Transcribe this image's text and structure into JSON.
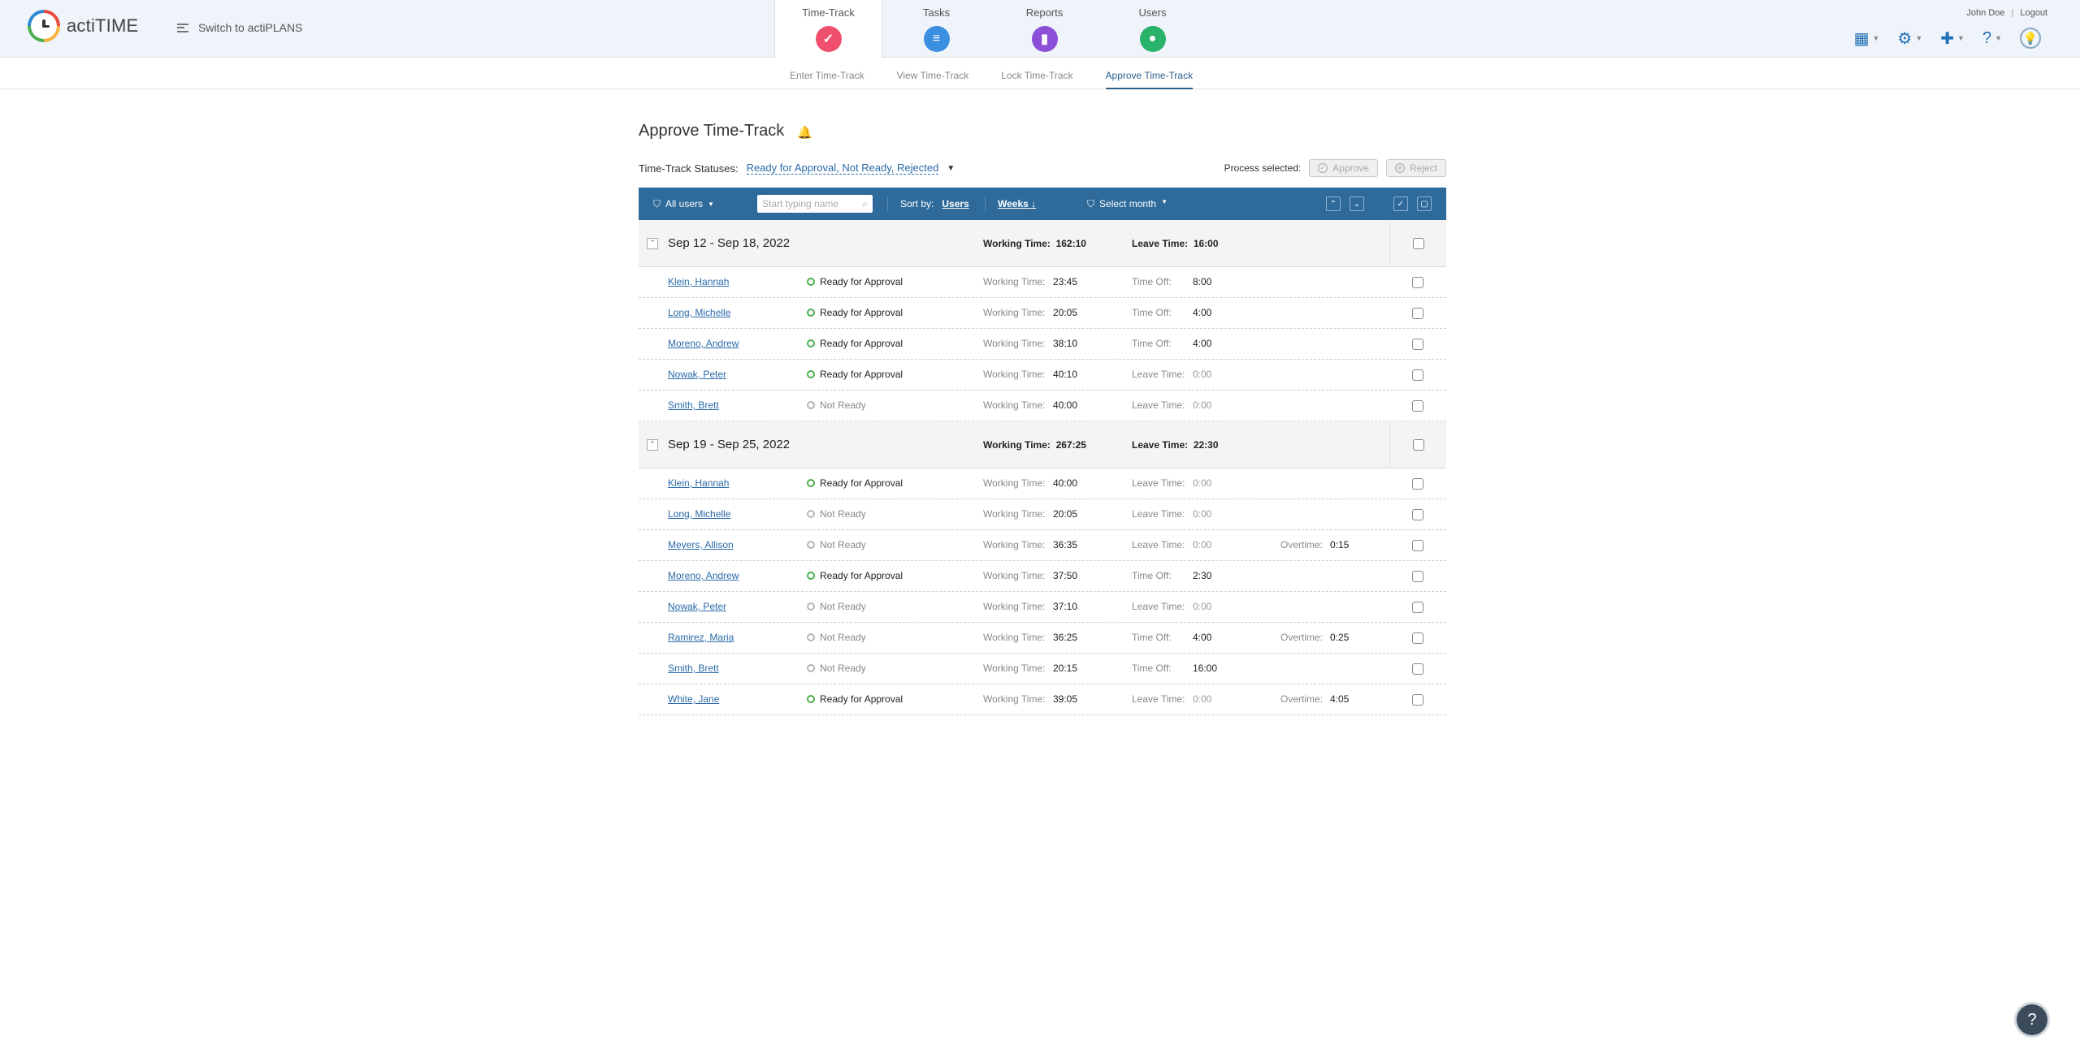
{
  "app": {
    "name": "actiTIME",
    "switch_label": "Switch to actiPLANS"
  },
  "modules": [
    {
      "label": "Time-Track",
      "color": "#f0506e",
      "glyph": "✓"
    },
    {
      "label": "Tasks",
      "color": "#3b8fe0",
      "glyph": "≡"
    },
    {
      "label": "Reports",
      "color": "#8b4fd8",
      "glyph": "▮"
    },
    {
      "label": "Users",
      "color": "#28b26a",
      "glyph": "●"
    }
  ],
  "user": {
    "name": "John Doe",
    "logout": "Logout"
  },
  "subnav": [
    "Enter Time-Track",
    "View Time-Track",
    "Lock Time-Track",
    "Approve Time-Track"
  ],
  "page": {
    "title": "Approve Time-Track"
  },
  "filters": {
    "statuses_label": "Time-Track Statuses:",
    "statuses_value": "Ready for Approval, Not Ready, Rejected",
    "process_label": "Process selected:",
    "approve": "Approve",
    "reject": "Reject"
  },
  "toolbar": {
    "all_users": "All users",
    "search_placeholder": "Start typing name",
    "sort_by": "Sort by:",
    "sort_users": "Users",
    "weeks": "Weeks",
    "select_month": "Select month"
  },
  "labels": {
    "working_time": "Working Time:",
    "leave_time": "Leave Time:",
    "time_off": "Time Off:",
    "overtime": "Overtime:"
  },
  "weeks": [
    {
      "title": "Sep 12 - Sep 18, 2022",
      "working_time": "162:10",
      "leave_time": "16:00",
      "rows": [
        {
          "name": "Klein, Hannah",
          "status": "Ready for Approval",
          "ready": true,
          "working": "23:45",
          "leave_type": "Time Off:",
          "leave": "8:00",
          "overtime": ""
        },
        {
          "name": "Long, Michelle",
          "status": "Ready for Approval",
          "ready": true,
          "working": "20:05",
          "leave_type": "Time Off:",
          "leave": "4:00",
          "overtime": ""
        },
        {
          "name": "Moreno, Andrew",
          "status": "Ready for Approval",
          "ready": true,
          "working": "38:10",
          "leave_type": "Time Off:",
          "leave": "4:00",
          "overtime": ""
        },
        {
          "name": "Nowak, Peter",
          "status": "Ready for Approval",
          "ready": true,
          "working": "40:10",
          "leave_type": "Leave Time:",
          "leave": "0:00",
          "overtime": ""
        },
        {
          "name": "Smith, Brett",
          "status": "Not Ready",
          "ready": false,
          "working": "40:00",
          "leave_type": "Leave Time:",
          "leave": "0:00",
          "overtime": ""
        }
      ]
    },
    {
      "title": "Sep 19 - Sep 25, 2022",
      "working_time": "267:25",
      "leave_time": "22:30",
      "rows": [
        {
          "name": "Klein, Hannah",
          "status": "Ready for Approval",
          "ready": true,
          "working": "40:00",
          "leave_type": "Leave Time:",
          "leave": "0:00",
          "overtime": ""
        },
        {
          "name": "Long, Michelle",
          "status": "Not Ready",
          "ready": false,
          "working": "20:05",
          "leave_type": "Leave Time:",
          "leave": "0:00",
          "overtime": ""
        },
        {
          "name": "Meyers, Allison",
          "status": "Not Ready",
          "ready": false,
          "working": "36:35",
          "leave_type": "Leave Time:",
          "leave": "0:00",
          "overtime": "0:15"
        },
        {
          "name": "Moreno, Andrew",
          "status": "Ready for Approval",
          "ready": true,
          "working": "37:50",
          "leave_type": "Time Off:",
          "leave": "2:30",
          "overtime": ""
        },
        {
          "name": "Nowak, Peter",
          "status": "Not Ready",
          "ready": false,
          "working": "37:10",
          "leave_type": "Leave Time:",
          "leave": "0:00",
          "overtime": ""
        },
        {
          "name": "Ramirez, Maria",
          "status": "Not Ready",
          "ready": false,
          "working": "36:25",
          "leave_type": "Time Off:",
          "leave": "4:00",
          "overtime": "0:25"
        },
        {
          "name": "Smith, Brett",
          "status": "Not Ready",
          "ready": false,
          "working": "20:15",
          "leave_type": "Time Off:",
          "leave": "16:00",
          "overtime": ""
        },
        {
          "name": "White, Jane",
          "status": "Ready for Approval",
          "ready": true,
          "working": "39:05",
          "leave_type": "Leave Time:",
          "leave": "0:00",
          "overtime": "4:05"
        }
      ]
    }
  ],
  "help": {
    "glyph": "?"
  }
}
